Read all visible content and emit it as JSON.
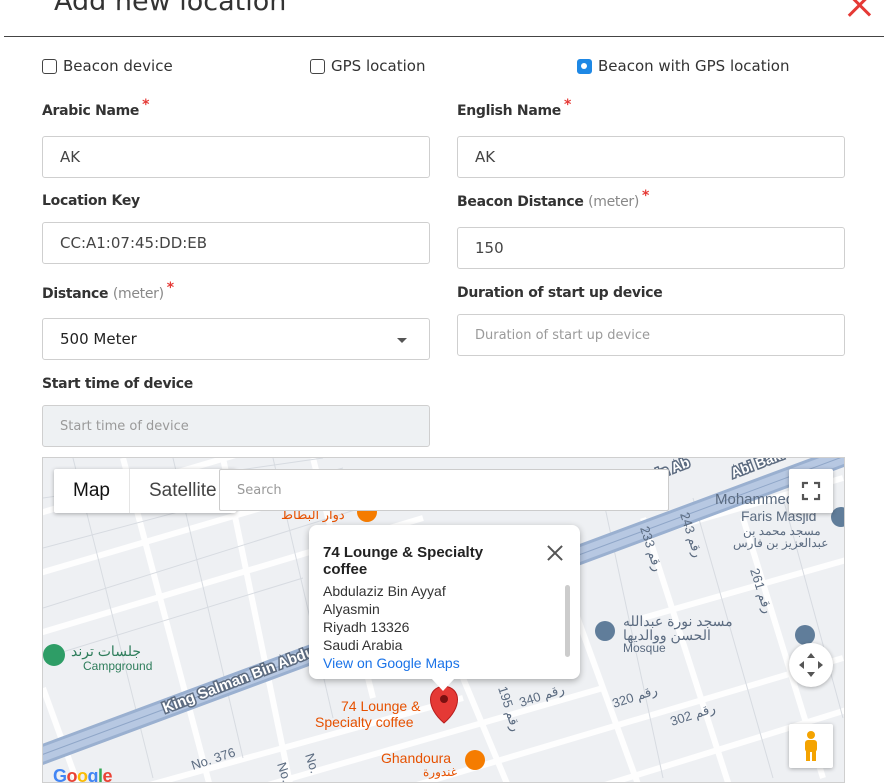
{
  "modal": {
    "title": "Add new location"
  },
  "options": [
    {
      "label": "Beacon device",
      "checked": false
    },
    {
      "label": "GPS location",
      "checked": false
    },
    {
      "label": "Beacon with GPS location",
      "checked": true
    }
  ],
  "form": {
    "arabic_name": {
      "label": "Arabic Name",
      "required": "*",
      "value": "AK"
    },
    "english_name": {
      "label": "English Name",
      "required": "*",
      "value": "AK"
    },
    "location_key": {
      "label": "Location Key",
      "value": "CC:A1:07:45:DD:EB"
    },
    "beacon_distance": {
      "label": "Beacon Distance",
      "unit": "(meter)",
      "required": "*",
      "value": "150"
    },
    "distance": {
      "label": "Distance",
      "unit": "(meter)",
      "required": "*",
      "selected": "500 Meter"
    },
    "startup_duration": {
      "label": "Duration of start up device",
      "placeholder": "Duration of start up device"
    },
    "start_time": {
      "label": "Start time of device",
      "placeholder": "Start time of device"
    }
  },
  "map": {
    "type_map": "Map",
    "type_satellite": "Satellite",
    "search_placeholder": "Search",
    "info": {
      "title": "74 Lounge & Specialty coffee",
      "address": [
        "Abdulaziz Bin Ayyaf",
        "Alyasmin",
        "Riyadh 13326",
        "Saudi Arabia"
      ],
      "link": "View on Google Maps"
    },
    "labels": {
      "king_salman": "King Salman Bin Abdu",
      "abi_bakr": "Abi Bakr",
      "bin_ab": "Bin Ab",
      "mohammed": "Mohammed",
      "faris": "Faris Masjid",
      "faris_ar": "مسجد محمد بن",
      "faris_ar2": "عبدالعزيز بن فارس",
      "dawar": "دوار البطاط",
      "campground_ar": "جلسات ترند",
      "campground": "Campground",
      "mosque_ar": "مسجد نورة عبدالله",
      "mosque_ar2": "الحسن ووالديها",
      "mosque": "Mosque",
      "lounge_1": "74 Lounge &",
      "lounge_2": "Specialty coffee",
      "ghandoura": "Ghandoura",
      "ghandoura_ar": "غندورة",
      "r233": "233 رقم",
      "r243": "243 رقم",
      "r261": "261 رقم",
      "r340": "340 رقم",
      "r320": "320 رقم",
      "r302": "302 رقم",
      "r195": "195 رقم",
      "no376": "No. 376",
      "no_a": "No.",
      "no_b": "No."
    },
    "google": "Google"
  }
}
